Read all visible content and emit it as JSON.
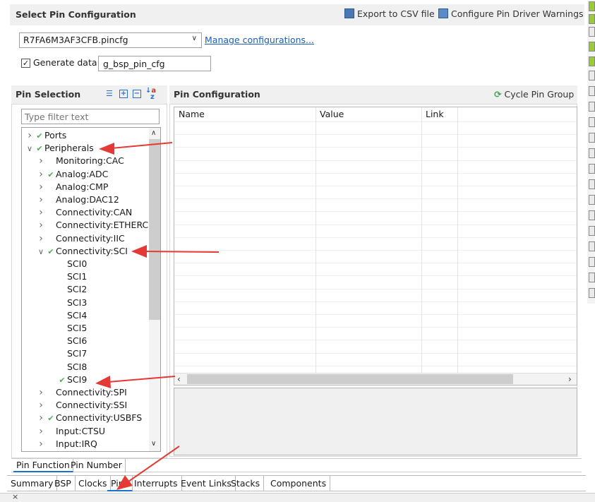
{
  "select_config": {
    "title": "Select Pin Configuration",
    "export_label": "Export to CSV file",
    "warnings_label": "Configure Pin Driver Warnings",
    "file_value": "R7FA6M3AF3CFB.pincfg",
    "manage_label": "Manage configurations...",
    "generate_label": "Generate data:",
    "generate_checked": true,
    "generate_value": "g_bsp_pin_cfg"
  },
  "pin_selection": {
    "title": "Pin Selection",
    "filter_placeholder": "Type filter text",
    "tree": [
      {
        "label": "Ports",
        "twisty": ">",
        "check": true,
        "indent": 0
      },
      {
        "label": "Peripherals",
        "twisty": "v",
        "check": true,
        "indent": 0
      },
      {
        "label": "Monitoring:CAC",
        "twisty": ">",
        "check": false,
        "indent": 1
      },
      {
        "label": "Analog:ADC",
        "twisty": ">",
        "check": true,
        "indent": 1
      },
      {
        "label": "Analog:CMP",
        "twisty": ">",
        "check": false,
        "indent": 1
      },
      {
        "label": "Analog:DAC12",
        "twisty": ">",
        "check": false,
        "indent": 1
      },
      {
        "label": "Connectivity:CAN",
        "twisty": ">",
        "check": false,
        "indent": 1
      },
      {
        "label": "Connectivity:ETHERC",
        "twisty": ">",
        "check": false,
        "indent": 1
      },
      {
        "label": "Connectivity:IIC",
        "twisty": ">",
        "check": false,
        "indent": 1
      },
      {
        "label": "Connectivity:SCI",
        "twisty": "v",
        "check": true,
        "indent": 1
      },
      {
        "label": "SCI0",
        "twisty": "",
        "check": false,
        "indent": 2
      },
      {
        "label": "SCI1",
        "twisty": "",
        "check": false,
        "indent": 2
      },
      {
        "label": "SCI2",
        "twisty": "",
        "check": false,
        "indent": 2
      },
      {
        "label": "SCI3",
        "twisty": "",
        "check": false,
        "indent": 2
      },
      {
        "label": "SCI4",
        "twisty": "",
        "check": false,
        "indent": 2
      },
      {
        "label": "SCI5",
        "twisty": "",
        "check": false,
        "indent": 2
      },
      {
        "label": "SCI6",
        "twisty": "",
        "check": false,
        "indent": 2
      },
      {
        "label": "SCI7",
        "twisty": "",
        "check": false,
        "indent": 2
      },
      {
        "label": "SCI8",
        "twisty": "",
        "check": false,
        "indent": 2
      },
      {
        "label": "SCI9",
        "twisty": "",
        "check": true,
        "indent": 2
      },
      {
        "label": "Connectivity:SPI",
        "twisty": ">",
        "check": false,
        "indent": 1
      },
      {
        "label": "Connectivity:SSI",
        "twisty": ">",
        "check": false,
        "indent": 1
      },
      {
        "label": "Connectivity:USBFS",
        "twisty": ">",
        "check": true,
        "indent": 1
      },
      {
        "label": "Input:CTSU",
        "twisty": ">",
        "check": false,
        "indent": 1
      },
      {
        "label": "Input:IRQ",
        "twisty": ">",
        "check": false,
        "indent": 1
      }
    ],
    "bottom_tabs": [
      "Pin Function",
      "Pin Number"
    ]
  },
  "pin_config": {
    "title": "Pin Configuration",
    "cycle_label": "Cycle Pin Group",
    "columns": [
      "Name",
      "Value",
      "Link"
    ]
  },
  "editor_tabs": [
    "Summary",
    "BSP",
    "Clocks",
    "Pins",
    "Interrupts",
    "Event Links",
    "Stacks",
    "Components"
  ],
  "active_editor_tab": "Pins",
  "colors": {
    "check": "#4caf50",
    "arrow": "#e53935",
    "link": "#1a5fb4"
  }
}
